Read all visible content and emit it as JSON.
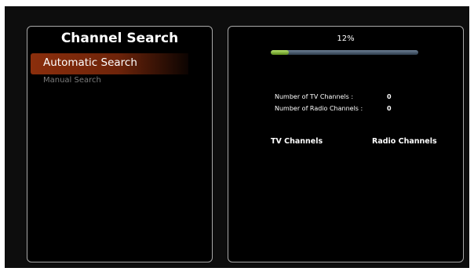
{
  "left_panel": {
    "title": "Channel Search",
    "menu": [
      {
        "label": "Automatic Search",
        "selected": true
      },
      {
        "label": "Manual Search",
        "selected": false
      }
    ]
  },
  "right_panel": {
    "progress": {
      "label": "12%",
      "value_percent": 12
    },
    "counts": [
      {
        "label": "Number of TV Channels :",
        "value": "0"
      },
      {
        "label": "Number of Radio Channels :",
        "value": "0"
      }
    ],
    "columns": [
      "TV Channels",
      "Radio Channels"
    ]
  },
  "colors": {
    "selection_accent": "#8a2e0c",
    "progress_fill": "#8cc63f",
    "panel_border": "#a9a9a9"
  }
}
